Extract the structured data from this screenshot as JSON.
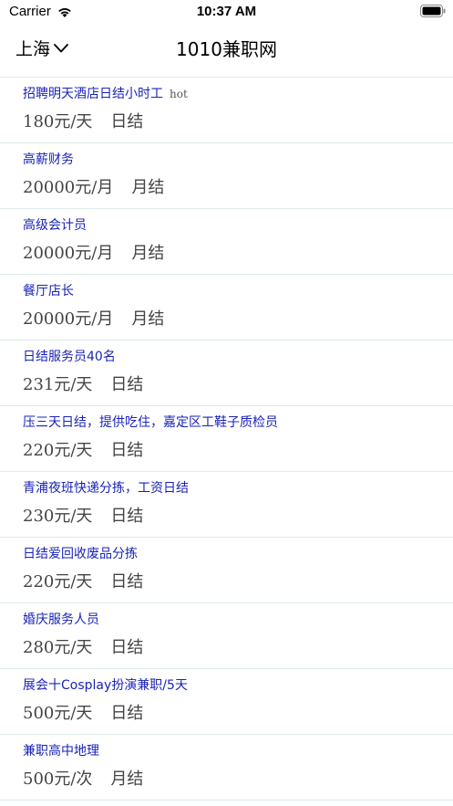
{
  "status_bar": {
    "carrier": "Carrier",
    "time": "10:37 AM"
  },
  "nav": {
    "city": "上海",
    "title": "1010兼职网"
  },
  "colors": {
    "link": "#1a23b8",
    "divider": "#dcebea",
    "meta_text": "#444444"
  },
  "jobs": [
    {
      "title": "招聘明天酒店日结小时工",
      "badge": "hot",
      "pay": "180元/天",
      "cycle": "日结"
    },
    {
      "title": "高薪财务",
      "badge": "",
      "pay": "20000元/月",
      "cycle": "月结"
    },
    {
      "title": "高级会计员",
      "badge": "",
      "pay": "20000元/月",
      "cycle": "月结"
    },
    {
      "title": "餐厅店长",
      "badge": "",
      "pay": "20000元/月",
      "cycle": "月结"
    },
    {
      "title": "日结服务员40名",
      "badge": "",
      "pay": "231元/天",
      "cycle": "日结"
    },
    {
      "title": "压三天日结，提供吃住，嘉定区工鞋子质检员",
      "badge": "",
      "pay": "220元/天",
      "cycle": "日结"
    },
    {
      "title": "青浦夜班快递分拣，工资日结",
      "badge": "",
      "pay": "230元/天",
      "cycle": "日结"
    },
    {
      "title": "日结爱回收废品分拣",
      "badge": "",
      "pay": "220元/天",
      "cycle": "日结"
    },
    {
      "title": "婚庆服务人员",
      "badge": "",
      "pay": "280元/天",
      "cycle": "日结"
    },
    {
      "title": "展会十Cosplay扮演兼职/5天",
      "badge": "",
      "pay": "500元/天",
      "cycle": "日结"
    },
    {
      "title": "兼职高中地理",
      "badge": "",
      "pay": "500元/次",
      "cycle": "月结"
    }
  ]
}
